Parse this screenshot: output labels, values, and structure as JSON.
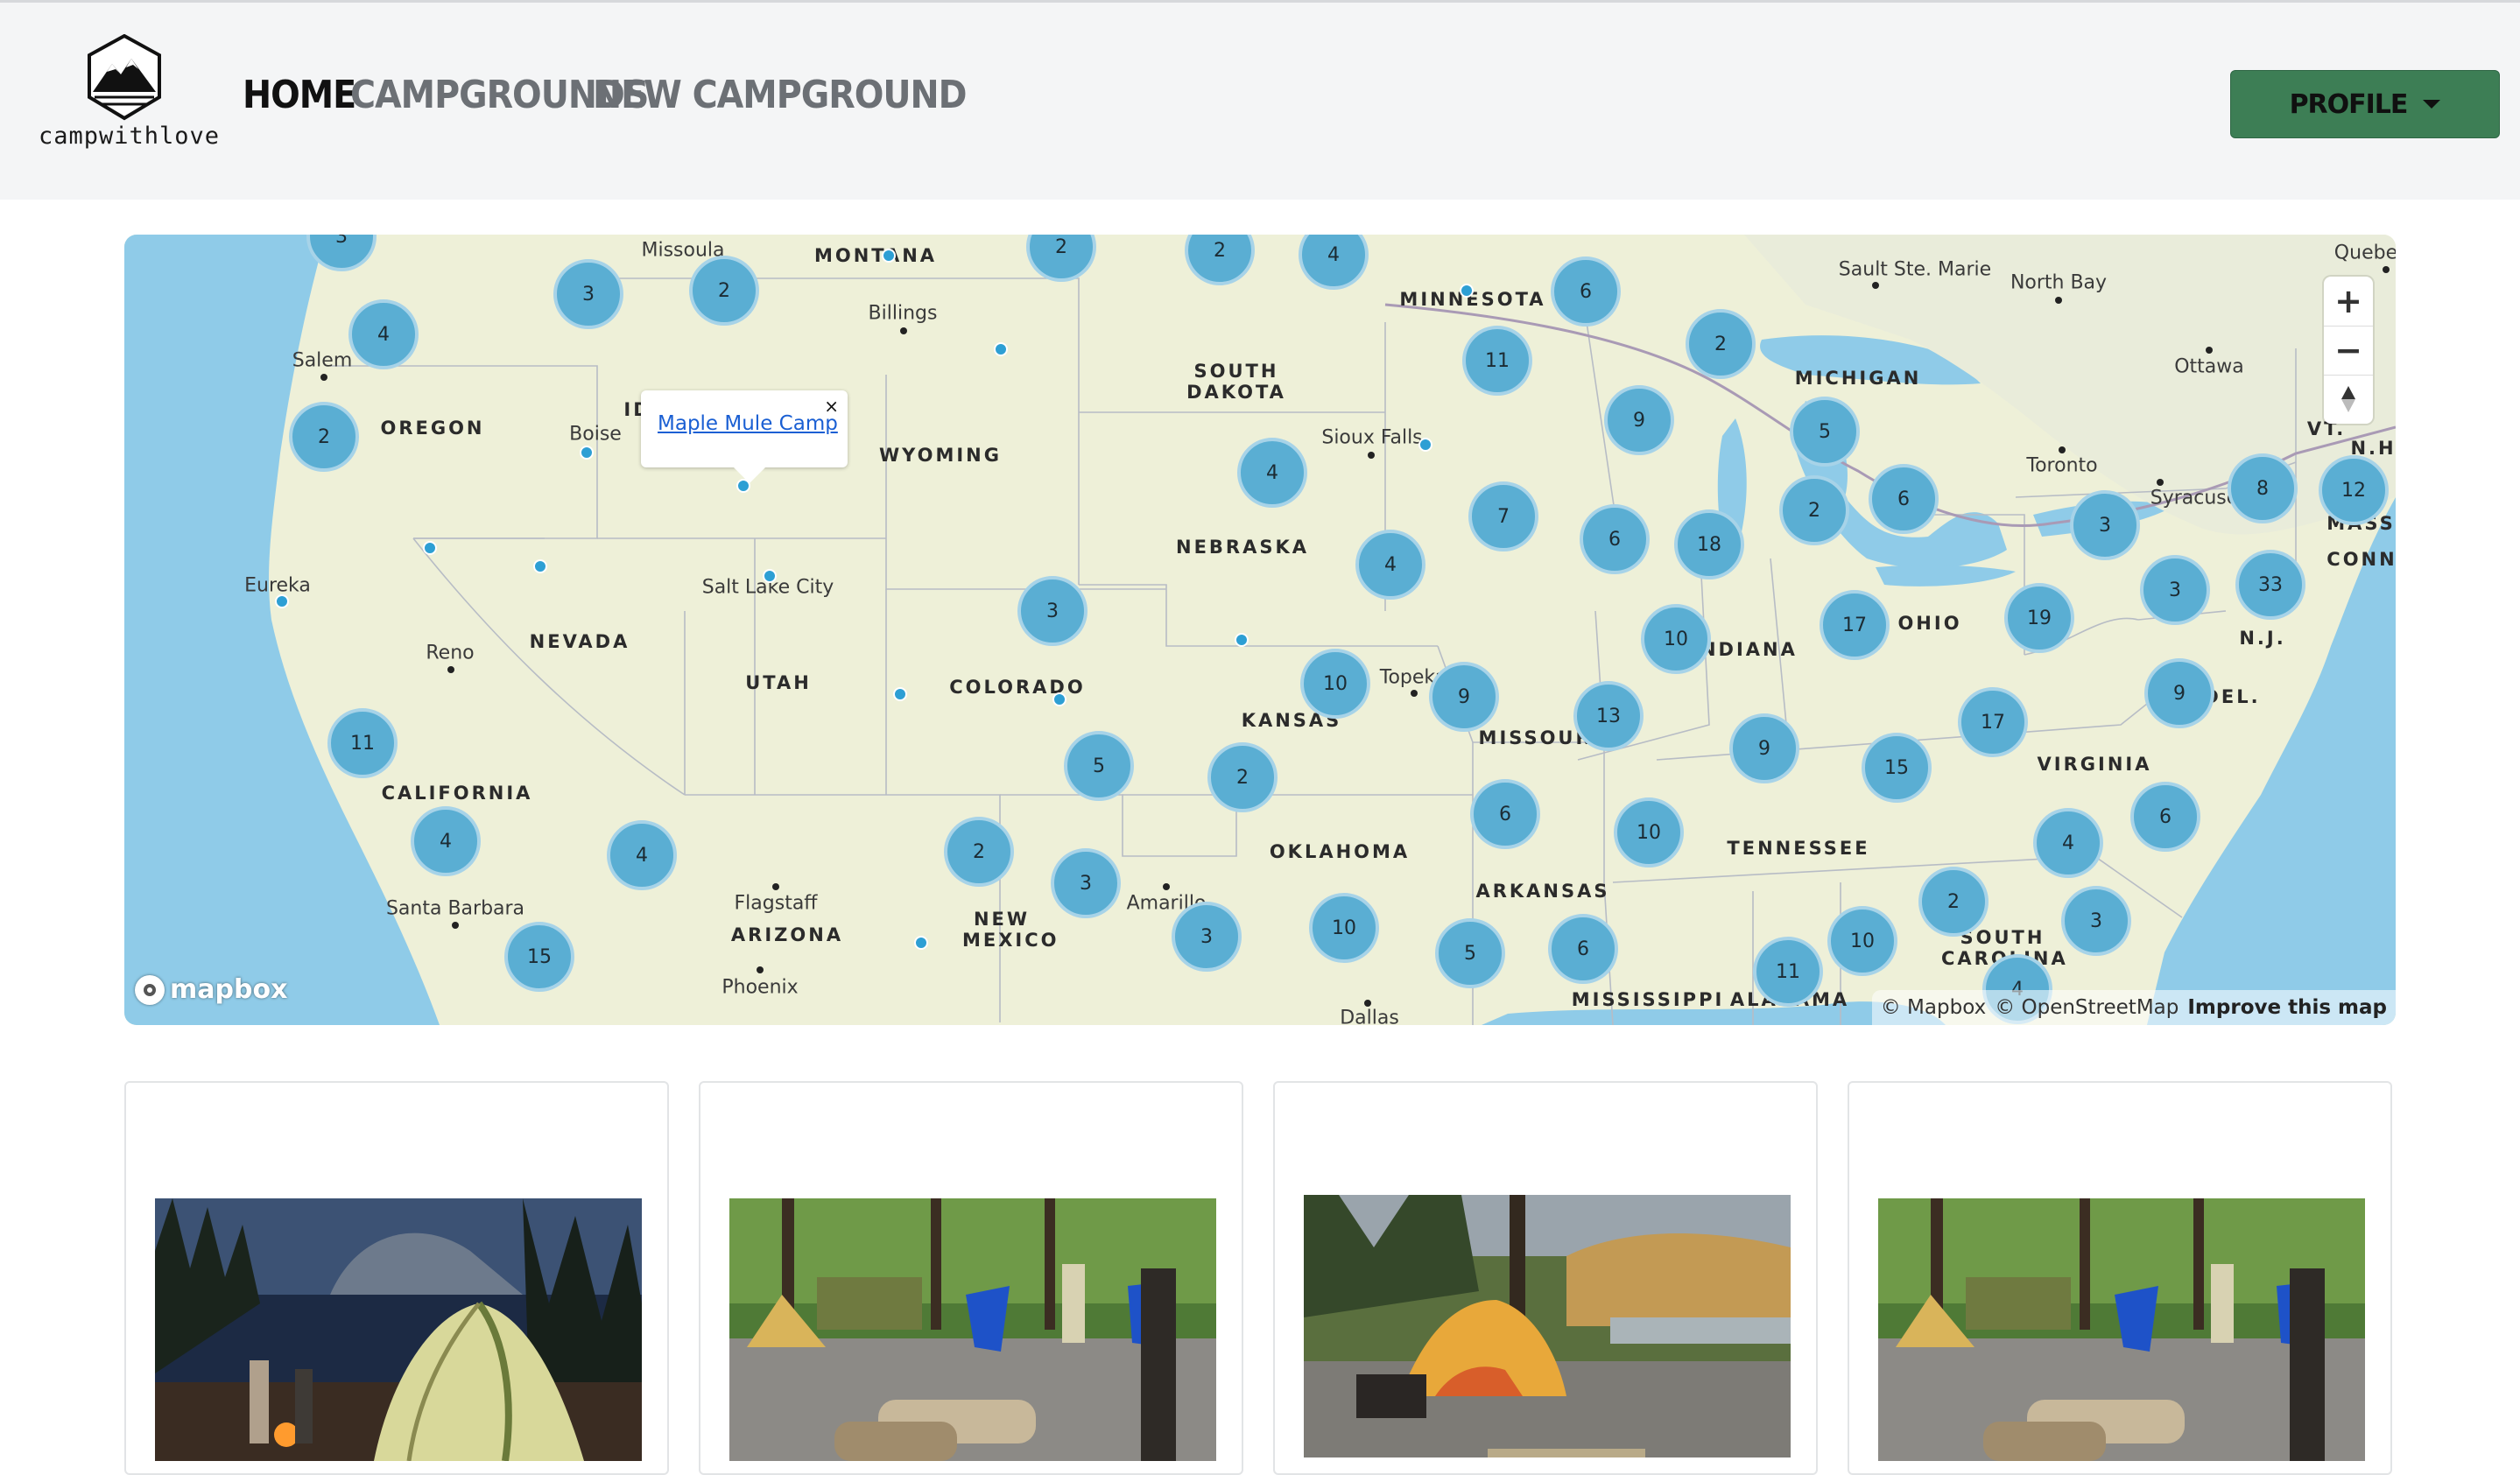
{
  "navbar": {
    "logo_text": "campwithlove",
    "links": [
      {
        "label": "Home",
        "active": true
      },
      {
        "label": "Campgrounds",
        "active": false
      },
      {
        "label": "New Campground",
        "active": false
      }
    ],
    "profile_label": "Profile"
  },
  "map": {
    "popup_title": "Maple Mule Camp",
    "popup_close": "×",
    "controls": {
      "zoom_in": "+",
      "zoom_out": "−",
      "compass": "▲"
    },
    "logo": "mapbox",
    "attribution": {
      "mapbox": "© Mapbox",
      "osm": "© OpenStreetMap",
      "improve": "Improve this map"
    },
    "states": [
      "MONTANA",
      "MINNESOTA",
      "SOUTH DAKOTA",
      "OREGON",
      "WYOMING",
      "MICHIGAN",
      "NEBRASKA",
      "NEVADA",
      "UTAH",
      "COLORADO",
      "KANSAS",
      "INDIANA",
      "OHIO",
      "MISSOURI",
      "CALIFORNIA",
      "VIRGINIA",
      "OKLAHOMA",
      "TENNESSEE",
      "ARKANSAS",
      "ARIZONA",
      "NEW MEXICO",
      "SOUTH CAROLINA",
      "MISSISSIPPI",
      "ALABAMA",
      "MASS.",
      "CONN.",
      "N.J.",
      "N.H.",
      "VT.",
      "ID",
      "DEL."
    ],
    "cities": [
      "Missoula",
      "Billings",
      "Sault Ste. Marie",
      "North Bay",
      "Quebec",
      "Ottawa",
      "Salem",
      "Boise",
      "Sioux Falls",
      "Toronto",
      "Syracuse",
      "Eureka",
      "Salt Lake City",
      "Reno",
      "Topeka",
      "Flagstaff",
      "Amarillo",
      "Santa Barbara",
      "Phoenix",
      "Dallas"
    ],
    "clusters": [
      "3",
      "2",
      "2",
      "2",
      "4",
      "6",
      "4",
      "11",
      "2",
      "2",
      "9",
      "5",
      "4",
      "8",
      "12",
      "6",
      "2",
      "6",
      "3",
      "7",
      "18",
      "4",
      "6",
      "3",
      "33",
      "17",
      "19",
      "3",
      "10",
      "10",
      "9",
      "13",
      "9",
      "17",
      "4",
      "15",
      "5",
      "2",
      "2",
      "10",
      "6",
      "6",
      "4",
      "3",
      "3",
      "10",
      "5",
      "6",
      "2",
      "3",
      "15",
      "11",
      "10",
      "4"
    ]
  },
  "cards": [
    {
      "photo": "tent-at-night"
    },
    {
      "photo": "campsite-chairs"
    },
    {
      "photo": "yellow-tent-lake"
    },
    {
      "photo": "campsite-chairs"
    }
  ]
}
